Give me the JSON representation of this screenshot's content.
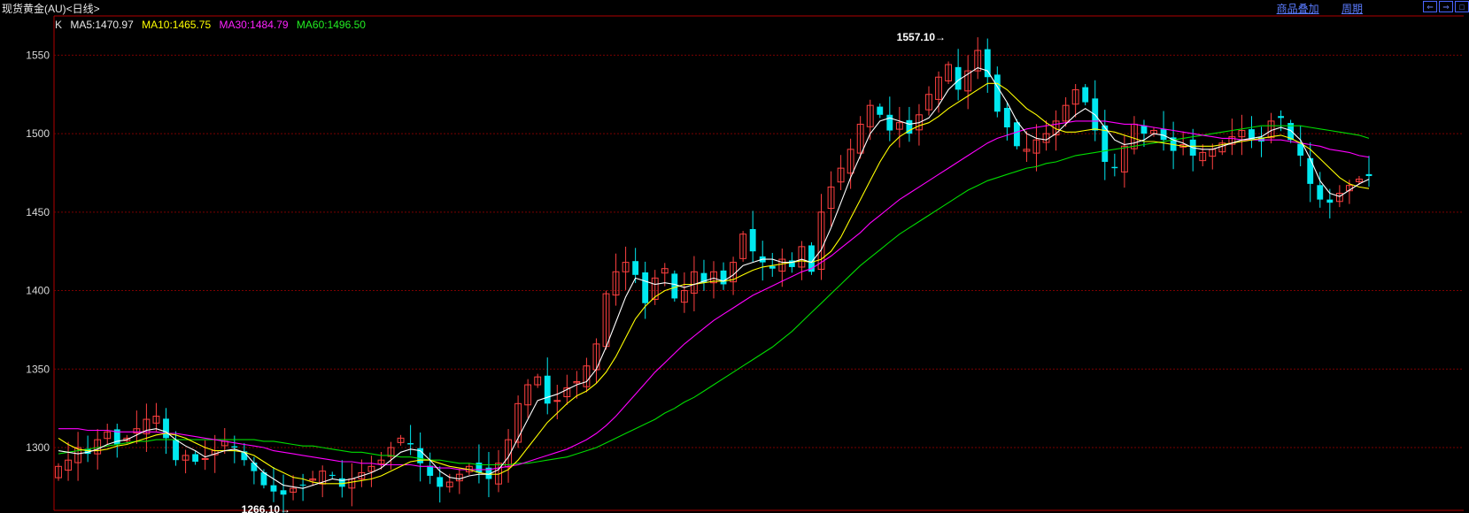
{
  "header": {
    "title": "现货黄金(AU)<日线>",
    "links": [
      "商品叠加",
      "周期"
    ],
    "window_buttons": [
      "⇐",
      "⇒",
      "□"
    ]
  },
  "ma_bar": {
    "k_label": "K",
    "ma5": "MA5:1470.97",
    "ma10": "MA10:1465.75",
    "ma30": "MA30:1484.79",
    "ma60": "MA60:1496.50"
  },
  "colors": {
    "background": "#000000",
    "grid": "#7a0000",
    "axis": "#b00000",
    "up": "#ff4040",
    "down": "#00e8f0",
    "ma5": "#ffffff",
    "ma10": "#ffff00",
    "ma30": "#ff00ff",
    "ma60": "#00dd00"
  },
  "chart_data": {
    "type": "candlestick",
    "ylim": [
      1260,
      1575
    ],
    "yticks": [
      1300,
      1350,
      1400,
      1450,
      1500,
      1550
    ],
    "annotations": [
      {
        "text": "1557.10→",
        "index": 91,
        "value": 1557.1
      },
      {
        "text": "1266.10→",
        "index": 24,
        "value": 1266.1
      }
    ],
    "closes": [
      1288,
      1292,
      1300,
      1296,
      1305,
      1310,
      1302,
      1306,
      1312,
      1318,
      1320,
      1306,
      1292,
      1295,
      1291,
      1293,
      1298,
      1304,
      1300,
      1292,
      1285,
      1276,
      1272,
      1270,
      1274,
      1276,
      1280,
      1285,
      1282,
      1275,
      1280,
      1284,
      1288,
      1292,
      1300,
      1306,
      1302,
      1290,
      1282,
      1275,
      1278,
      1283,
      1288,
      1284,
      1280,
      1290,
      1305,
      1328,
      1340,
      1345,
      1328,
      1330,
      1338,
      1342,
      1352,
      1366,
      1398,
      1412,
      1418,
      1410,
      1392,
      1408,
      1414,
      1395,
      1400,
      1412,
      1405,
      1412,
      1404,
      1418,
      1436,
      1425,
      1418,
      1414,
      1420,
      1415,
      1428,
      1412,
      1450,
      1466,
      1478,
      1490,
      1506,
      1518,
      1512,
      1502,
      1507,
      1500,
      1512,
      1525,
      1536,
      1544,
      1528,
      1540,
      1553,
      1536,
      1514,
      1504,
      1492,
      1490,
      1496,
      1500,
      1508,
      1518,
      1528,
      1520,
      1502,
      1482,
      1478,
      1492,
      1506,
      1500,
      1502,
      1496,
      1489,
      1493,
      1486,
      1488,
      1490,
      1494,
      1498,
      1502,
      1496,
      1495,
      1508,
      1510,
      1496,
      1486,
      1468,
      1458,
      1456,
      1462,
      1467,
      1471,
      1473
    ],
    "ma5": [
      1298,
      1297,
      1296,
      1297,
      1299,
      1302,
      1304,
      1305,
      1308,
      1311,
      1312,
      1310,
      1305,
      1301,
      1298,
      1294,
      1296,
      1298,
      1299,
      1297,
      1290,
      1284,
      1280,
      1276,
      1275,
      1274,
      1276,
      1278,
      1280,
      1279,
      1280,
      1282,
      1284,
      1287,
      1292,
      1297,
      1299,
      1298,
      1292,
      1285,
      1281,
      1280,
      1282,
      1283,
      1283,
      1286,
      1294,
      1306,
      1318,
      1330,
      1332,
      1334,
      1337,
      1340,
      1342,
      1350,
      1364,
      1380,
      1396,
      1408,
      1406,
      1404,
      1405,
      1404,
      1402,
      1404,
      1406,
      1408,
      1406,
      1410,
      1416,
      1418,
      1420,
      1420,
      1418,
      1418,
      1420,
      1418,
      1426,
      1440,
      1456,
      1472,
      1486,
      1500,
      1508,
      1510,
      1508,
      1506,
      1507,
      1510,
      1518,
      1528,
      1534,
      1538,
      1542,
      1540,
      1530,
      1520,
      1508,
      1500,
      1497,
      1496,
      1500,
      1506,
      1512,
      1516,
      1512,
      1504,
      1496,
      1493,
      1494,
      1496,
      1500,
      1499,
      1496,
      1494,
      1491,
      1490,
      1490,
      1492,
      1494,
      1496,
      1497,
      1498,
      1502,
      1504,
      1502,
      1496,
      1484,
      1470,
      1462,
      1460,
      1464,
      1468,
      1471
    ],
    "ma10": [
      1306,
      1302,
      1299,
      1298,
      1298,
      1299,
      1301,
      1302,
      1304,
      1306,
      1308,
      1309,
      1308,
      1306,
      1303,
      1300,
      1298,
      1298,
      1298,
      1297,
      1295,
      1291,
      1287,
      1284,
      1281,
      1280,
      1278,
      1277,
      1277,
      1277,
      1278,
      1279,
      1280,
      1282,
      1285,
      1288,
      1291,
      1292,
      1292,
      1290,
      1288,
      1287,
      1286,
      1284,
      1283,
      1283,
      1286,
      1292,
      1300,
      1308,
      1316,
      1322,
      1328,
      1333,
      1336,
      1341,
      1348,
      1358,
      1370,
      1382,
      1390,
      1396,
      1400,
      1402,
      1404,
      1404,
      1405,
      1406,
      1406,
      1407,
      1410,
      1413,
      1415,
      1416,
      1417,
      1418,
      1419,
      1418,
      1420,
      1425,
      1434,
      1446,
      1458,
      1470,
      1482,
      1492,
      1498,
      1502,
      1505,
      1507,
      1511,
      1516,
      1520,
      1524,
      1528,
      1532,
      1532,
      1528,
      1522,
      1516,
      1512,
      1507,
      1503,
      1501,
      1501,
      1502,
      1503,
      1502,
      1501,
      1499,
      1497,
      1495,
      1495,
      1494,
      1493,
      1492,
      1492,
      1492,
      1492,
      1493,
      1494,
      1495,
      1496,
      1497,
      1498,
      1499,
      1497,
      1494,
      1490,
      1484,
      1478,
      1472,
      1468,
      1466,
      1465
    ],
    "ma30": [
      1312,
      1312,
      1312,
      1311,
      1311,
      1311,
      1310,
      1310,
      1310,
      1310,
      1310,
      1309,
      1309,
      1308,
      1307,
      1306,
      1305,
      1304,
      1303,
      1302,
      1301,
      1300,
      1298,
      1297,
      1296,
      1295,
      1294,
      1293,
      1292,
      1291,
      1291,
      1290,
      1290,
      1289,
      1289,
      1289,
      1289,
      1288,
      1288,
      1287,
      1287,
      1286,
      1286,
      1286,
      1286,
      1287,
      1288,
      1289,
      1291,
      1293,
      1295,
      1297,
      1299,
      1302,
      1305,
      1309,
      1314,
      1320,
      1327,
      1334,
      1341,
      1348,
      1354,
      1360,
      1366,
      1371,
      1376,
      1381,
      1385,
      1389,
      1393,
      1397,
      1400,
      1403,
      1406,
      1409,
      1412,
      1414,
      1418,
      1422,
      1427,
      1432,
      1437,
      1443,
      1448,
      1453,
      1458,
      1462,
      1466,
      1470,
      1474,
      1478,
      1482,
      1486,
      1490,
      1494,
      1497,
      1499,
      1501,
      1503,
      1504,
      1505,
      1506,
      1507,
      1508,
      1508,
      1508,
      1508,
      1507,
      1506,
      1506,
      1505,
      1504,
      1503,
      1502,
      1501,
      1500,
      1499,
      1498,
      1497,
      1497,
      1496,
      1496,
      1496,
      1496,
      1496,
      1495,
      1494,
      1493,
      1492,
      1490,
      1489,
      1488,
      1486,
      1485
    ],
    "ma60": [
      1296,
      1297,
      1298,
      1299,
      1300,
      1301,
      1302,
      1303,
      1304,
      1304,
      1305,
      1305,
      1305,
      1305,
      1305,
      1305,
      1305,
      1305,
      1305,
      1305,
      1305,
      1304,
      1304,
      1303,
      1302,
      1301,
      1301,
      1300,
      1299,
      1298,
      1297,
      1297,
      1296,
      1295,
      1295,
      1294,
      1294,
      1293,
      1292,
      1292,
      1291,
      1290,
      1290,
      1289,
      1289,
      1289,
      1289,
      1290,
      1290,
      1291,
      1292,
      1293,
      1294,
      1296,
      1298,
      1300,
      1303,
      1306,
      1309,
      1312,
      1315,
      1318,
      1322,
      1325,
      1329,
      1332,
      1336,
      1340,
      1344,
      1348,
      1352,
      1356,
      1360,
      1364,
      1369,
      1374,
      1380,
      1386,
      1392,
      1398,
      1404,
      1410,
      1416,
      1421,
      1426,
      1431,
      1436,
      1440,
      1444,
      1448,
      1452,
      1456,
      1460,
      1464,
      1467,
      1470,
      1472,
      1474,
      1476,
      1478,
      1479,
      1481,
      1482,
      1484,
      1486,
      1487,
      1488,
      1489,
      1490,
      1491,
      1492,
      1493,
      1494,
      1495,
      1496,
      1497,
      1498,
      1499,
      1500,
      1501,
      1502,
      1503,
      1504,
      1505,
      1505,
      1505,
      1505,
      1505,
      1504,
      1503,
      1502,
      1501,
      1500,
      1499,
      1497
    ]
  }
}
